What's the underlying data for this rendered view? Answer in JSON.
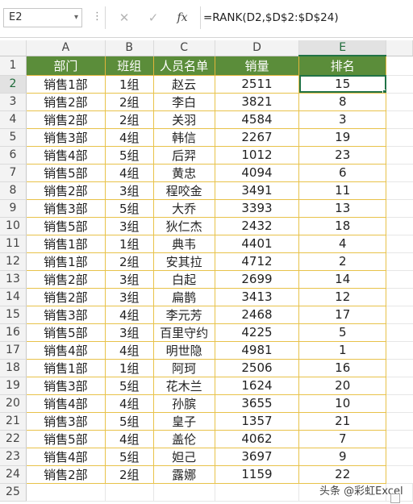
{
  "formula_bar": {
    "name_box": "E2",
    "cancel_icon": "✕",
    "enter_icon": "✓",
    "fx_label": "fx",
    "formula": "=RANK(D2,$D$2:$D$24)"
  },
  "columns": [
    "A",
    "B",
    "C",
    "D",
    "E"
  ],
  "row_numbers": [
    "1",
    "2",
    "3",
    "4",
    "5",
    "6",
    "7",
    "8",
    "9",
    "10",
    "11",
    "12",
    "13",
    "14",
    "15",
    "16",
    "17",
    "18",
    "19",
    "20",
    "21",
    "22",
    "23",
    "24",
    "25"
  ],
  "header": [
    "部门",
    "班组",
    "人员名单",
    "销量",
    "排名"
  ],
  "rows": [
    [
      "销售1部",
      "1组",
      "赵云",
      "2511",
      "15"
    ],
    [
      "销售2部",
      "2组",
      "李白",
      "3821",
      "8"
    ],
    [
      "销售2部",
      "2组",
      "关羽",
      "4584",
      "3"
    ],
    [
      "销售3部",
      "4组",
      "韩信",
      "2267",
      "19"
    ],
    [
      "销售4部",
      "5组",
      "后羿",
      "1012",
      "23"
    ],
    [
      "销售5部",
      "4组",
      "黄忠",
      "4094",
      "6"
    ],
    [
      "销售2部",
      "3组",
      "程咬金",
      "3491",
      "11"
    ],
    [
      "销售3部",
      "5组",
      "大乔",
      "3393",
      "13"
    ],
    [
      "销售5部",
      "3组",
      "狄仁杰",
      "2432",
      "18"
    ],
    [
      "销售1部",
      "1组",
      "典韦",
      "4401",
      "4"
    ],
    [
      "销售1部",
      "2组",
      "安其拉",
      "4712",
      "2"
    ],
    [
      "销售2部",
      "3组",
      "白起",
      "2699",
      "14"
    ],
    [
      "销售2部",
      "3组",
      "扁鹊",
      "3413",
      "12"
    ],
    [
      "销售3部",
      "4组",
      "李元芳",
      "2468",
      "17"
    ],
    [
      "销售5部",
      "3组",
      "百里守约",
      "4225",
      "5"
    ],
    [
      "销售4部",
      "4组",
      "明世隐",
      "4981",
      "1"
    ],
    [
      "销售1部",
      "1组",
      "阿珂",
      "2506",
      "16"
    ],
    [
      "销售3部",
      "5组",
      "花木兰",
      "1624",
      "20"
    ],
    [
      "销售4部",
      "4组",
      "孙膑",
      "3655",
      "10"
    ],
    [
      "销售3部",
      "5组",
      "皇子",
      "1357",
      "21"
    ],
    [
      "销售5部",
      "4组",
      "盖伦",
      "4062",
      "7"
    ],
    [
      "销售4部",
      "5组",
      "妲己",
      "3697",
      "9"
    ],
    [
      "销售2部",
      "2组",
      "露娜",
      "1159",
      "22"
    ]
  ],
  "watermark": "头条 @彩虹Excel",
  "colors": {
    "header_fill": "#5b8d3a",
    "border_gold": "#e8c24a",
    "selection": "#217346"
  }
}
